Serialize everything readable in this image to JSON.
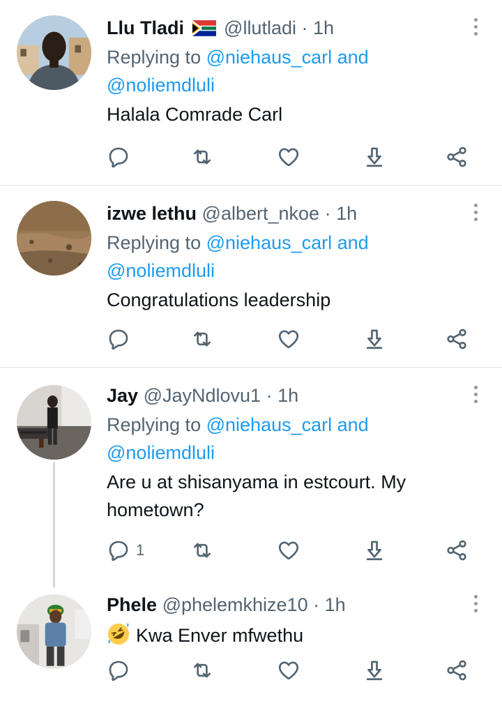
{
  "tweets": [
    {
      "name": "Llu Tladi",
      "flag": "south-africa-flag",
      "handle": "@llutladi",
      "time": "1h",
      "replying_prefix": "Replying to",
      "mention1": "@niehaus_carl",
      "and": "and",
      "mention2": "@noliemdluli",
      "text": "Halala Comrade Carl",
      "reply_count": ""
    },
    {
      "name": "izwe lethu",
      "handle": "@albert_nkoe",
      "time": "1h",
      "replying_prefix": "Replying to",
      "mention1": "@niehaus_carl",
      "and": "and",
      "mention2": "@noliemdluli",
      "text": "Congratulations leadership",
      "reply_count": ""
    },
    {
      "name": "Jay",
      "handle": "@JayNdlovu1",
      "time": "1h",
      "replying_prefix": "Replying to",
      "mention1": "@niehaus_carl",
      "and": "and",
      "mention2": "@noliemdluli",
      "text_line1": "Are u at shisanyama in estcourt. My",
      "text_line2": "hometown?",
      "reply_count": "1"
    },
    {
      "name": "Phele",
      "handle": "@phelemkhize10",
      "time": "1h",
      "emoji": "rolling-on-floor-laughing-emoji",
      "text": "Kwa Enver mfwethu",
      "reply_count": ""
    }
  ],
  "separator": "·",
  "colors": {
    "link": "#1d9bf0",
    "secondary_text": "#536471",
    "primary_text": "#0f1419",
    "icon": "#536471",
    "divider": "#dfe3e7"
  },
  "icons": [
    "reply-icon",
    "retweet-icon",
    "like-icon",
    "download-icon",
    "share-icon",
    "more-menu-icon"
  ]
}
